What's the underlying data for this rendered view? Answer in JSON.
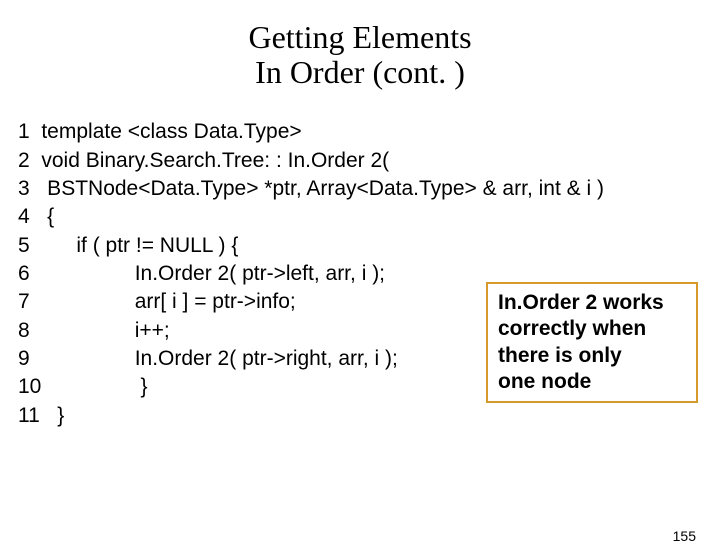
{
  "title_line1": "Getting Elements",
  "title_line2": "In Order (cont. )",
  "code": {
    "l1": "1  template <class Data.Type>",
    "l2": "2  void Binary.Search.Tree: : In.Order 2(",
    "l3": "3   BSTNode<Data.Type> *ptr, Array<Data.Type> & arr, int & i )",
    "l4": "4   {",
    "l5": "5        if ( ptr != NULL ) {",
    "l6": "6                  In.Order 2( ptr->left, arr, i );",
    "l7": "7                  arr[ i ] = ptr->info;",
    "l8": "8                  i++;",
    "l9": "9                  In.Order 2( ptr->right, arr, i );",
    "l10": "10                 }",
    "l11": "11   }"
  },
  "callout": {
    "l1": "In.Order 2 works",
    "l2": "correctly when",
    "l3": "there is only",
    "l4": "one node"
  },
  "page_number": "155"
}
